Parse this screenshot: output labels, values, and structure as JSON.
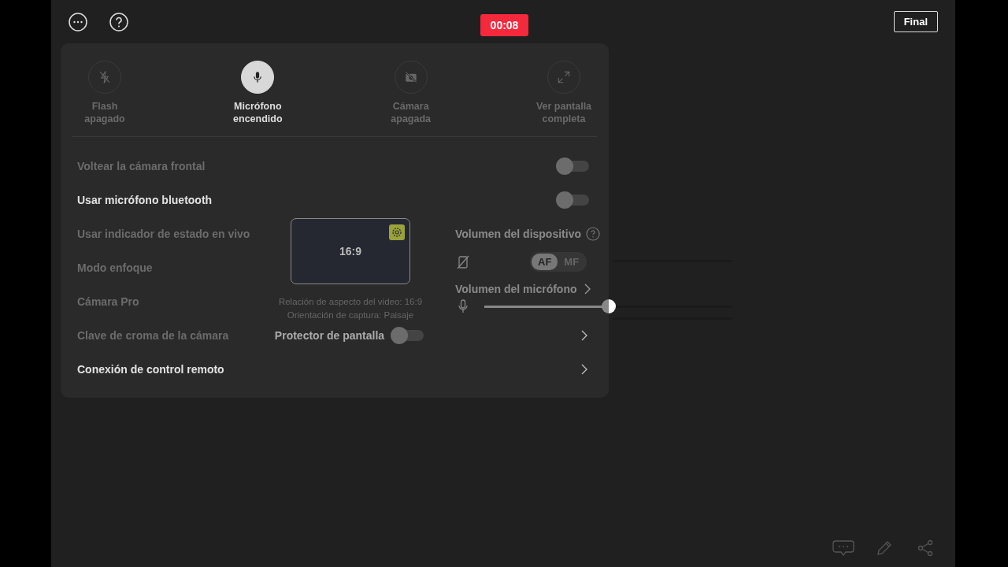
{
  "top_bar": {
    "timer": "00:08",
    "end_button": "Final"
  },
  "quick_actions": [
    {
      "kind": "flash",
      "label": "Flash apagado",
      "selected": false
    },
    {
      "kind": "mic",
      "label": "Micrófono encendido",
      "selected": true
    },
    {
      "kind": "camera",
      "label": "Cámara apagada",
      "selected": false
    },
    {
      "kind": "fullscreen",
      "label": "Ver pantalla completa",
      "selected": false
    }
  ],
  "settings": [
    {
      "label": "Voltear la cámara frontal",
      "kind": "toggle",
      "disabled": true,
      "on": false
    },
    {
      "label": "Usar micrófono bluetooth",
      "kind": "toggle",
      "disabled": false,
      "on": false
    },
    {
      "label": "Usar indicador de estado en vivo",
      "kind": "plain",
      "disabled": true
    },
    {
      "label": "Modo enfoque",
      "kind": "plain",
      "disabled": true
    },
    {
      "label": "Cámara Pro",
      "kind": "plain",
      "disabled": true
    },
    {
      "label": "Clave de croma de la cámara",
      "kind": "chevron",
      "disabled": true
    },
    {
      "label": "Conexión de control remoto",
      "kind": "chevron",
      "disabled": false
    }
  ],
  "aspect_card": {
    "ratio": "16:9",
    "captions": [
      "Relación de aspecto del video: 16:9",
      "Orientación de captura: Paisaje"
    ],
    "protector": {
      "label": "Protector de pantalla",
      "on": false
    }
  },
  "volume_panel": {
    "device_title": "Volumen del dispositivo",
    "focus_modes": [
      {
        "label": "AF",
        "selected": true
      },
      {
        "label": "MF",
        "selected": false
      }
    ],
    "mic_title": "Volumen del micrófono",
    "mic_level": {
      "level": 0.5
    }
  }
}
